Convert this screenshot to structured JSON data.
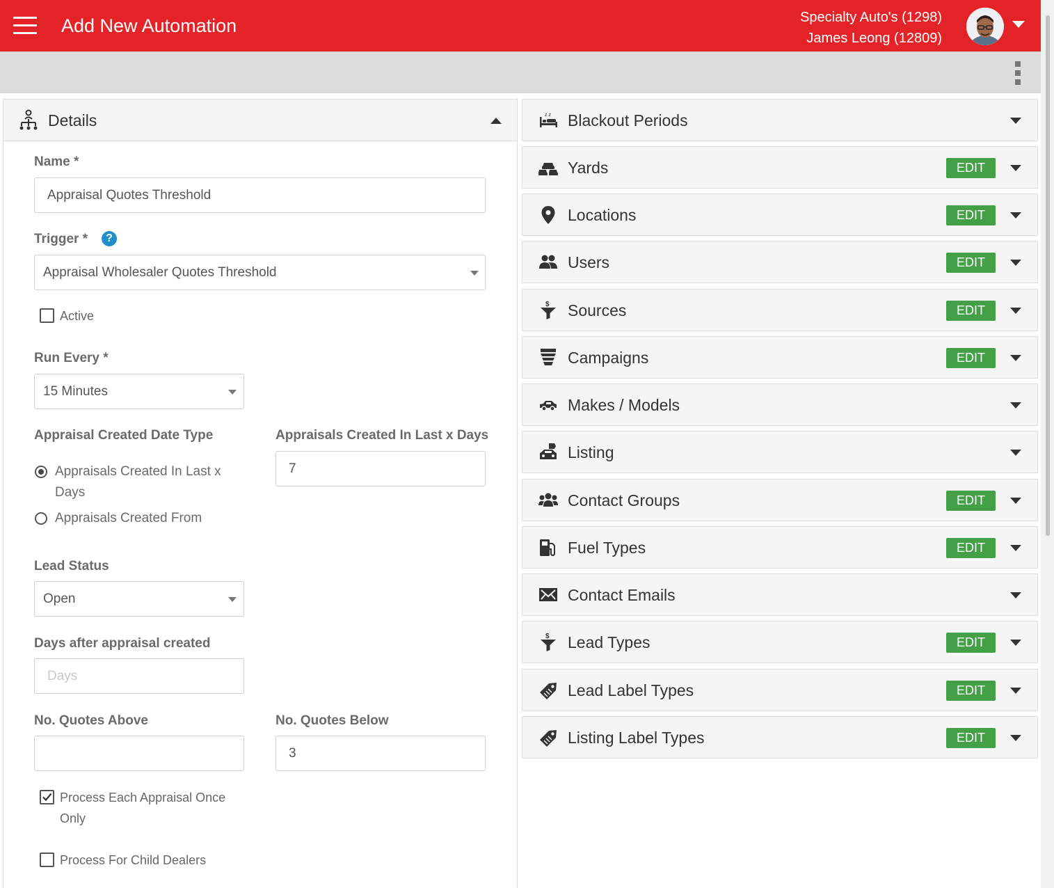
{
  "header": {
    "title": "Add New Automation",
    "dealer": "Specialty Auto's (1298)",
    "user": "James Leong (12809)"
  },
  "colors": {
    "brand_red": "#e32327",
    "edit_green": "#43a047",
    "help_blue": "#1f8ec9"
  },
  "details": {
    "title": "Details",
    "name_label": "Name *",
    "name_value": "Appraisal Quotes Threshold",
    "trigger_label": "Trigger *",
    "trigger_value": "Appraisal Wholesaler Quotes Threshold",
    "active_label": "Active",
    "active_checked": false,
    "run_every_label": "Run Every *",
    "run_every_value": "15 Minutes",
    "date_type_label": "Appraisal Created Date Type",
    "date_type_options": [
      "Appraisals Created In Last x Days",
      "Appraisals Created From"
    ],
    "date_type_selected": 0,
    "last_x_days_label": "Appraisals Created In Last x Days",
    "last_x_days_value": "7",
    "lead_status_label": "Lead Status",
    "lead_status_value": "Open",
    "days_after_label": "Days after appraisal created",
    "days_after_placeholder": "Days",
    "quotes_above_label": "No. Quotes Above",
    "quotes_above_value": "",
    "quotes_below_label": "No. Quotes Below",
    "quotes_below_value": "3",
    "process_once_label": "Process Each Appraisal Once Only",
    "process_once_checked": true,
    "child_dealers_label": "Process For Child Dealers",
    "child_dealers_checked": false
  },
  "sections": [
    {
      "title": "Blackout Periods",
      "icon": "bed-icon",
      "edit": false
    },
    {
      "title": "Yards",
      "icon": "cars-icon",
      "edit": true
    },
    {
      "title": "Locations",
      "icon": "map-pin-icon",
      "edit": true
    },
    {
      "title": "Users",
      "icon": "users-icon",
      "edit": true
    },
    {
      "title": "Sources",
      "icon": "funnel-dollar-icon",
      "edit": true
    },
    {
      "title": "Campaigns",
      "icon": "layers-icon",
      "edit": true
    },
    {
      "title": "Makes / Models",
      "icon": "car-side-icon",
      "edit": false
    },
    {
      "title": "Listing",
      "icon": "car-tag-icon",
      "edit": false
    },
    {
      "title": "Contact Groups",
      "icon": "group-icon",
      "edit": true
    },
    {
      "title": "Fuel Types",
      "icon": "fuel-pump-icon",
      "edit": true
    },
    {
      "title": "Contact Emails",
      "icon": "envelope-icon",
      "edit": false
    },
    {
      "title": "Lead Types",
      "icon": "funnel-dollar-icon",
      "edit": true
    },
    {
      "title": "Lead Label Types",
      "icon": "tag-icon",
      "edit": true
    },
    {
      "title": "Listing Label Types",
      "icon": "tag-icon",
      "edit": true
    }
  ],
  "edit_label": "EDIT"
}
